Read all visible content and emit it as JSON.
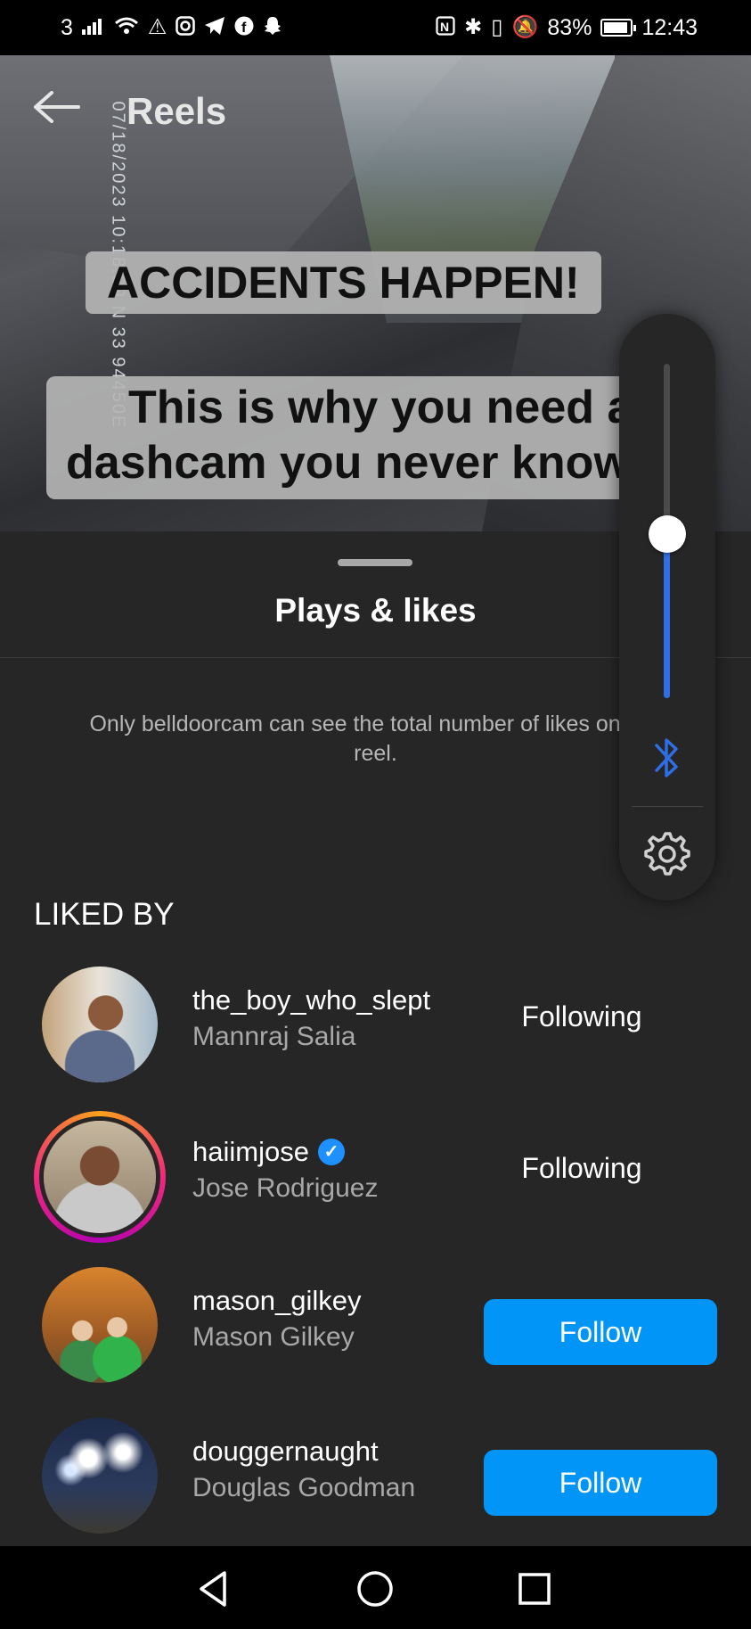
{
  "status_bar": {
    "carrier": "3",
    "battery_percent": "83%",
    "time": "12:43"
  },
  "header": {
    "title": "Reels",
    "back_icon": "arrow-left-icon"
  },
  "video": {
    "timestamp": "07/18/2023 10:18:39  N 33 94450E",
    "caption_line1": "ACCIDENTS HAPPEN!",
    "caption_line2a": "This is why you need a",
    "caption_line2b": "dashcam you never know"
  },
  "sheet": {
    "title": "Plays & likes",
    "info": "Only belldoorcam can see the total number of likes on this reel.",
    "section_header": "LIKED BY"
  },
  "users": [
    {
      "username": "the_boy_who_slept",
      "full_name": "Mannraj Salia",
      "action": "Following",
      "verified": false,
      "story": false
    },
    {
      "username": "haiimjose",
      "full_name": "Jose Rodriguez",
      "action": "Following",
      "verified": true,
      "story": true
    },
    {
      "username": "mason_gilkey",
      "full_name": "Mason Gilkey",
      "action": "Follow",
      "verified": false,
      "story": false
    },
    {
      "username": "douggernaught",
      "full_name": "Douglas Goodman",
      "action": "Follow",
      "verified": false,
      "story": false
    }
  ],
  "volume_panel": {
    "level": 0.49,
    "accent_color": "#2f6fe6",
    "bluetooth_icon": "bluetooth-icon",
    "settings_icon": "gear-icon"
  },
  "colors": {
    "follow_button": "#0095f6",
    "background": "#262626"
  }
}
